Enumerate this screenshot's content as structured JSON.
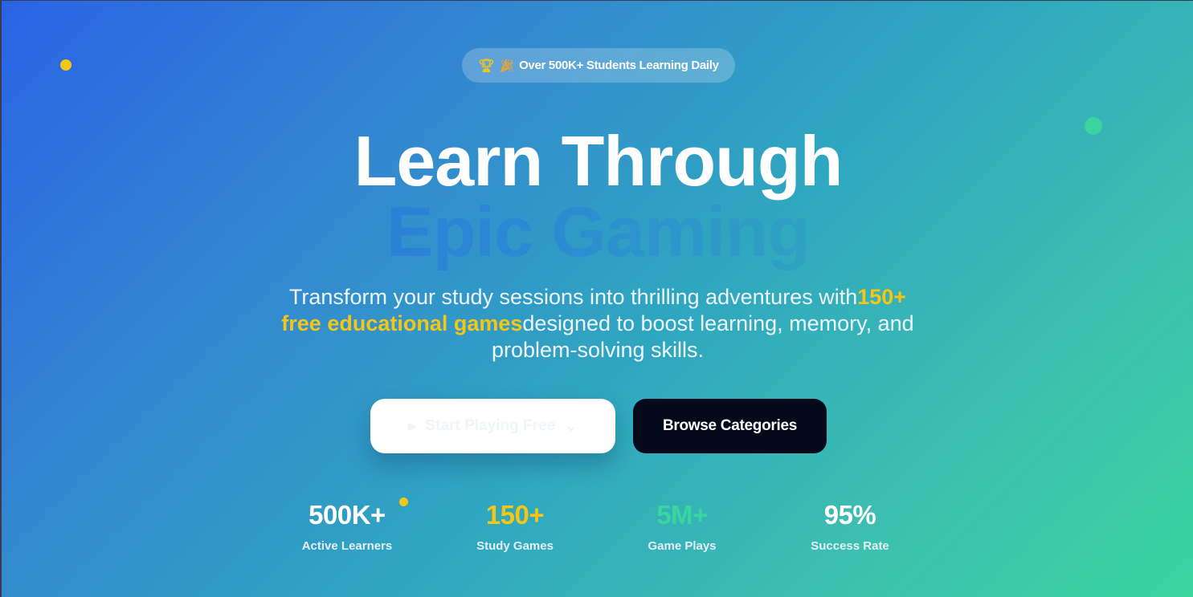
{
  "badge": {
    "trophy_icon": "trophy-icon",
    "party_icon": "party-popper-icon",
    "text": "Over 500K+ Students Learning Daily"
  },
  "hero": {
    "line1": "Learn Through",
    "line2": "Epic Gaming",
    "subtitle_before": "Transform your study sessions into thrilling adventures with",
    "subtitle_highlight": "150+ free educational games",
    "subtitle_after": "designed to boost learning, memory, and problem-solving skills."
  },
  "buttons": {
    "start_label": "Start Playing Free",
    "browse_label": "Browse Categories"
  },
  "stats": [
    {
      "value": "500K+",
      "label": "Active Learners",
      "color": "#ffffff"
    },
    {
      "value": "150+",
      "label": "Study Games",
      "color": "#f5c518"
    },
    {
      "value": "5M+",
      "label": "Game Plays",
      "color": "#3ad49e"
    },
    {
      "value": "95%",
      "label": "Success Rate",
      "color": "#ffffff"
    }
  ],
  "colors": {
    "accent_yellow": "#f5c518",
    "accent_green": "#3ad49e",
    "button_dark": "#050a1a"
  }
}
